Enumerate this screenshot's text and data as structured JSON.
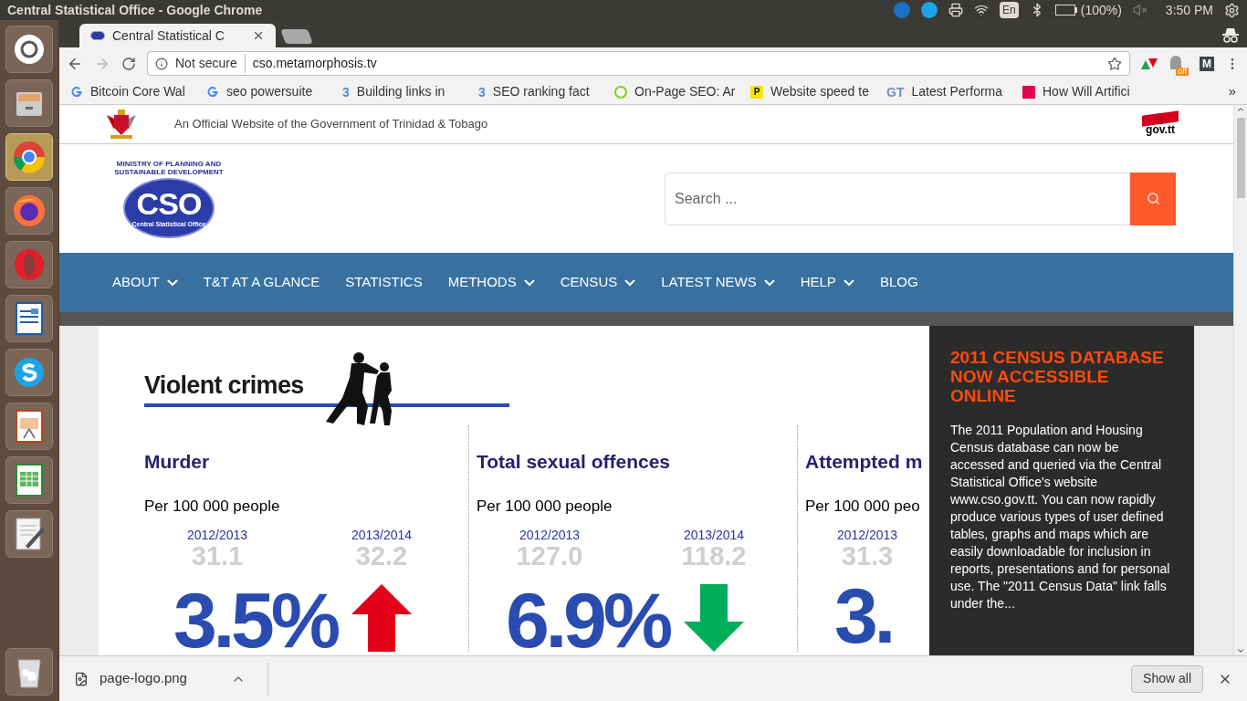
{
  "window": {
    "title": "Central Statistical Office - Google Chrome"
  },
  "system_tray": {
    "language": "En",
    "battery": "(100%)",
    "clock": "3:50 PM"
  },
  "launcher": [
    {
      "kind": "ubuntu",
      "selected": false
    },
    {
      "kind": "files",
      "selected": false
    },
    {
      "kind": "chrome",
      "selected": true
    },
    {
      "kind": "firefox",
      "selected": false
    },
    {
      "kind": "opera",
      "selected": false
    },
    {
      "kind": "writer",
      "selected": false
    },
    {
      "kind": "skype",
      "selected": false
    },
    {
      "kind": "impress",
      "selected": false
    },
    {
      "kind": "calc",
      "selected": false
    },
    {
      "kind": "editor",
      "selected": false
    },
    {
      "kind": "trash",
      "selected": false
    }
  ],
  "tabs": [
    {
      "title": "Central Statistical C",
      "selected": true
    }
  ],
  "address_bar": {
    "security": "Not secure",
    "url": "cso.metamorphosis.tv"
  },
  "extensions": [
    {
      "kind": "arrows"
    },
    {
      "kind": "ghost",
      "badge": "off"
    },
    {
      "kind": "letter",
      "letter": "M"
    }
  ],
  "bookmarks": [
    {
      "title": "Bitcoin Core Wal",
      "kind": "google"
    },
    {
      "title": "seo powersuite",
      "kind": "google"
    },
    {
      "title": "Building links in",
      "kind": "text",
      "icon_text": "3",
      "color": "#4a90d9"
    },
    {
      "title": "SEO ranking fact",
      "kind": "text",
      "icon_text": "3",
      "color": "#4a90d9"
    },
    {
      "title": "On-Page SEO: Ar",
      "kind": "ring",
      "color": "#7ed321"
    },
    {
      "title": "Website speed te",
      "kind": "square",
      "icon_text": "P",
      "color": "#f5e600"
    },
    {
      "title": "Latest Performa",
      "kind": "text",
      "icon_text": "GT",
      "color": "#6f8fc8"
    },
    {
      "title": "How Will Artifici",
      "kind": "square",
      "color": "#e0004d"
    }
  ],
  "bookmarks_more": "»",
  "site": {
    "gov_banner": "An Official Website of the Government of Trinidad & Tobago",
    "gov_logo": "gov.tt",
    "logo": {
      "arc": "MINISTRY OF PLANNING AND SUSTAINABLE DEVELOPMENT",
      "name": "CSO",
      "subtitle": "Central Statistical Office"
    },
    "search": {
      "placeholder": "Search ..."
    },
    "nav": [
      {
        "label": "ABOUT",
        "dropdown": true
      },
      {
        "label": "T&T AT A GLANCE",
        "dropdown": false
      },
      {
        "label": "STATISTICS",
        "dropdown": false
      },
      {
        "label": "METHODS",
        "dropdown": true
      },
      {
        "label": "CENSUS",
        "dropdown": true
      },
      {
        "label": "LATEST NEWS",
        "dropdown": true
      },
      {
        "label": "HELP",
        "dropdown": true
      },
      {
        "label": "BLOG",
        "dropdown": false
      }
    ]
  },
  "infographic": {
    "title": "Violent crimes",
    "stats": [
      {
        "title": "Murder",
        "unit": "Per 100 000 people",
        "years": [
          {
            "label": "2012/2013",
            "value": "31.1"
          },
          {
            "label": "2013/2014",
            "value": "32.2"
          }
        ],
        "change": "3.5%",
        "kind": "up"
      },
      {
        "title": "Total sexual offences",
        "unit": "Per 100 000 people",
        "years": [
          {
            "label": "2012/2013",
            "value": "127.0"
          },
          {
            "label": "2013/2014",
            "value": "118.2"
          }
        ],
        "change": "6.9%",
        "kind": "down"
      },
      {
        "title": "Attempted m",
        "unit": "Per 100 000 peo",
        "years": [
          {
            "label": "2012/2013",
            "value": "31.3"
          }
        ],
        "change": "3."
      }
    ]
  },
  "news_panel": {
    "title": "2011 CENSUS DATABASE NOW ACCESSIBLE ONLINE",
    "body": "The 2011 Population and Housing Census database can now be accessed and queried via the Central Statistical Office's website www.cso.gov.tt. You can now rapidly produce various types of user defined tables, graphs and maps which are easily downloadable for inclusion in reports, presentations and for personal use. The \"2011 Census Data\" link falls under the..."
  },
  "download_bar": {
    "file": "page-logo.png",
    "show_all": "Show all"
  }
}
